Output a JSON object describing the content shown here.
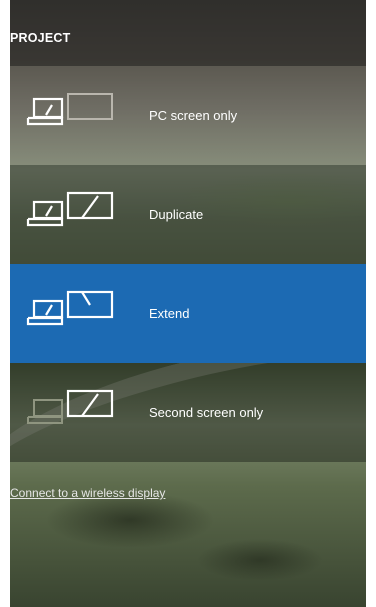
{
  "panel": {
    "title": "PROJECT",
    "options": [
      {
        "label": "PC screen only",
        "icon": "pc-screen-only-icon"
      },
      {
        "label": "Duplicate",
        "icon": "duplicate-icon"
      },
      {
        "label": "Extend",
        "icon": "extend-icon",
        "selected": true
      },
      {
        "label": "Second screen only",
        "icon": "second-screen-only-icon"
      }
    ],
    "wireless_link": "Connect to a wireless display"
  },
  "colors": {
    "selected_background": "#1c6ab3",
    "text": "#ffffff"
  }
}
